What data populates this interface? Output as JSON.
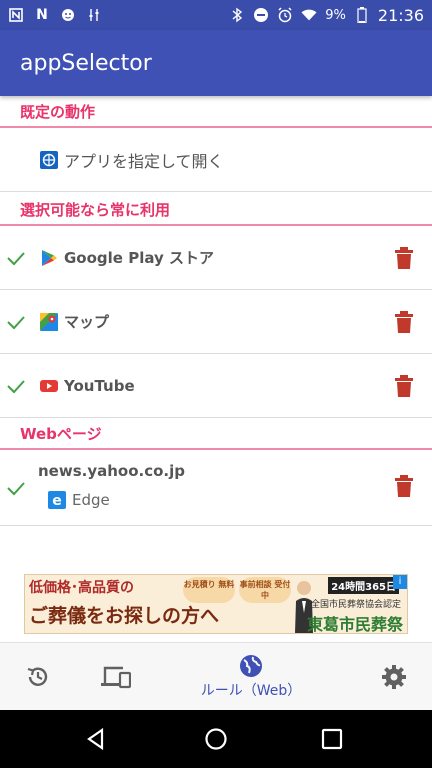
{
  "status_bar": {
    "battery": "9%",
    "time": "21:36",
    "left_icons": [
      "notification-icon",
      "n-icon",
      "face-icon",
      "tuning-icon"
    ],
    "right_icons": [
      "bluetooth-icon",
      "dnd-icon",
      "alarm-icon",
      "wifi-icon",
      "battery-icon"
    ]
  },
  "app_bar": {
    "title": "appSelector"
  },
  "sections": {
    "default_action": {
      "header": "既定の動作",
      "item_label": "アプリを指定して開く"
    },
    "always_use": {
      "header": "選択可能なら常に利用",
      "items": [
        {
          "label": "Google Play ストア",
          "icon": "google-play-icon"
        },
        {
          "label": "マップ",
          "icon": "maps-icon"
        },
        {
          "label": "YouTube",
          "icon": "youtube-icon"
        }
      ]
    },
    "web_pages": {
      "header": "Webページ",
      "items": [
        {
          "domain": "news.yahoo.co.jp",
          "app": "Edge",
          "app_icon": "edge-icon"
        }
      ]
    }
  },
  "ad": {
    "line1": "低価格･高品質の",
    "line2": "ご葬儀をお探しの方へ",
    "badge1": "お見積り 無料",
    "badge2": "事前相談 受付中",
    "right_top": "24時間365日",
    "right_mid": "全国市民葬祭協会認定",
    "right_main": "東葛市民葬祭",
    "info": "i"
  },
  "tab_bar": {
    "tabs": [
      {
        "name": "history",
        "icon": "history-icon",
        "label": ""
      },
      {
        "name": "devices",
        "icon": "devices-icon",
        "label": ""
      },
      {
        "name": "rules-web",
        "icon": "globe-icon",
        "label": "ルール（Web）",
        "active": true
      },
      {
        "name": "settings",
        "icon": "gear-icon",
        "label": ""
      }
    ]
  },
  "colors": {
    "app_bar": "#3f51b5",
    "status_bar": "#3b4dab",
    "section_header": "#e8336b",
    "check": "#43a047",
    "trash": "#c0392b"
  }
}
